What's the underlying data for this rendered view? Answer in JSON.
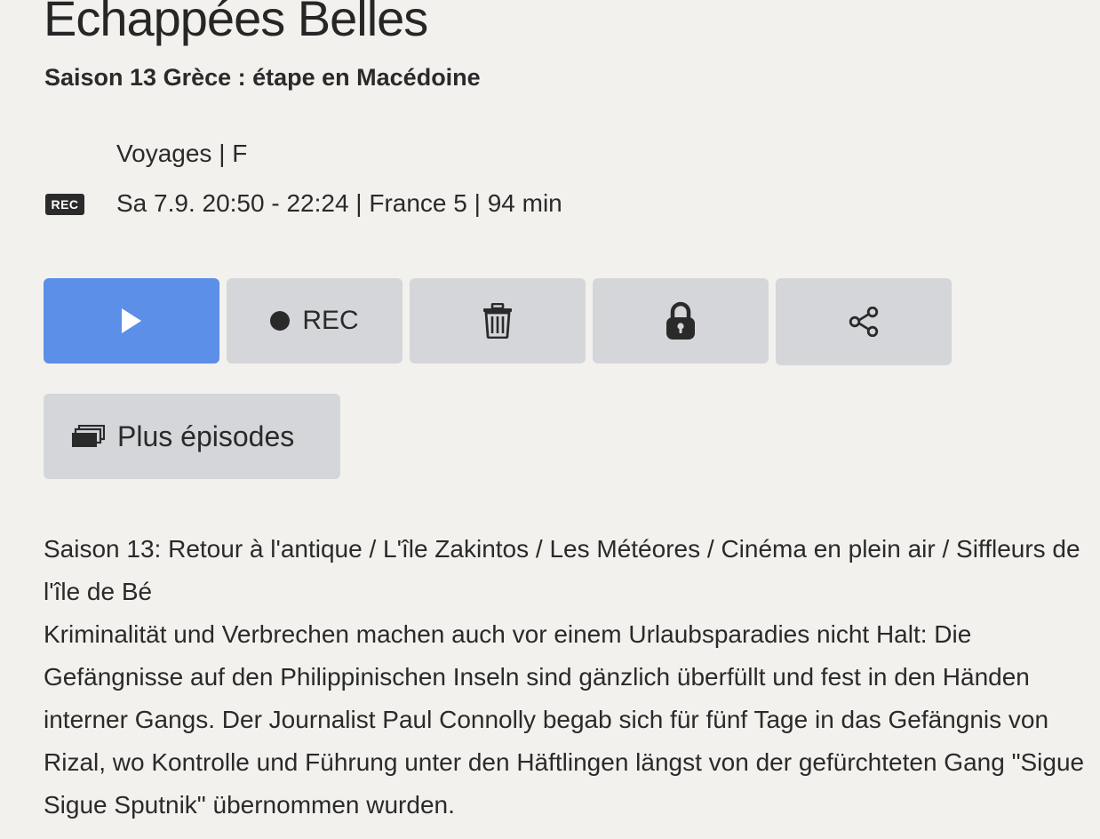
{
  "program": {
    "title": "Echappées Belles",
    "subtitle": "Saison 13 Grèce : étape en Macédoine",
    "genre_line": "Voyages | F",
    "rec_badge": "REC",
    "schedule_line": "Sa 7.9. 20:50 - 22:24 | France 5 | 94 min"
  },
  "actions": {
    "rec_label": "REC",
    "more_episodes_label": "Plus épisodes"
  },
  "description": {
    "line1": "Saison 13: Retour à l'antique / L'île Zakintos / Les Météores / Cinéma en plein air / Siffleurs de l'île de Bé",
    "line2": "Kriminalität und Verbrechen machen auch vor einem Urlaubsparadies nicht Halt: Die Gefängnisse auf den Philippinischen Inseln sind gänzlich überfüllt und fest in den Händen interner Gangs. Der Journalist Paul Connolly begab sich für fünf Tage in das Gefängnis von Rizal, wo Kontrolle und Führung unter den Häftlingen längst von der gefürchteten Gang \"Sigue Sigue Sputnik\" übernommen wurden."
  },
  "icons": {
    "play": "play-icon",
    "record": "record-dot-icon",
    "delete": "trash-icon",
    "lock": "lock-icon",
    "share": "share-icon",
    "episodes": "stacked-episodes-icon"
  },
  "colors": {
    "background": "#f2f1ee",
    "play_button": "#5b8fe8",
    "secondary_button": "#d4d6da",
    "text": "#2a2a2a",
    "rec_badge": "#2b2b2b"
  }
}
